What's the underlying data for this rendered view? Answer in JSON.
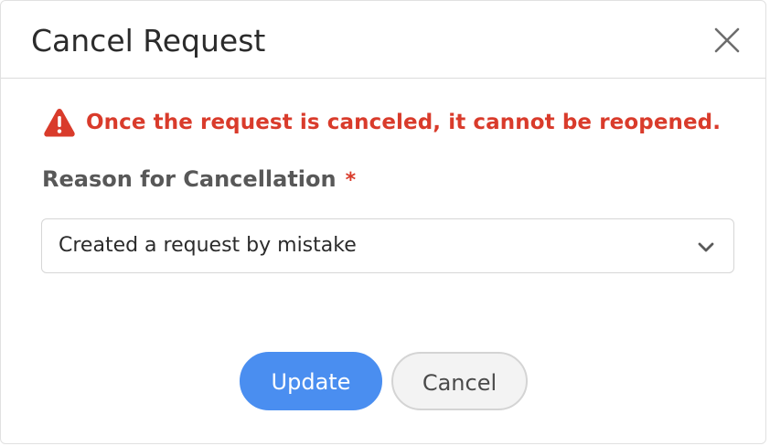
{
  "dialog": {
    "title": "Cancel Request",
    "close_icon": "close-icon"
  },
  "warning": {
    "icon": "warning-triangle-icon",
    "text": "Once the request is canceled, it cannot be reopened.",
    "color": "#d93b2b"
  },
  "reason": {
    "label": "Reason for Cancellation",
    "required_marker": "*",
    "selected_value": "Created a request by mistake",
    "dropdown_icon": "chevron-down-icon"
  },
  "actions": {
    "update_label": "Update",
    "cancel_label": "Cancel",
    "primary_color": "#4a8ef0"
  }
}
